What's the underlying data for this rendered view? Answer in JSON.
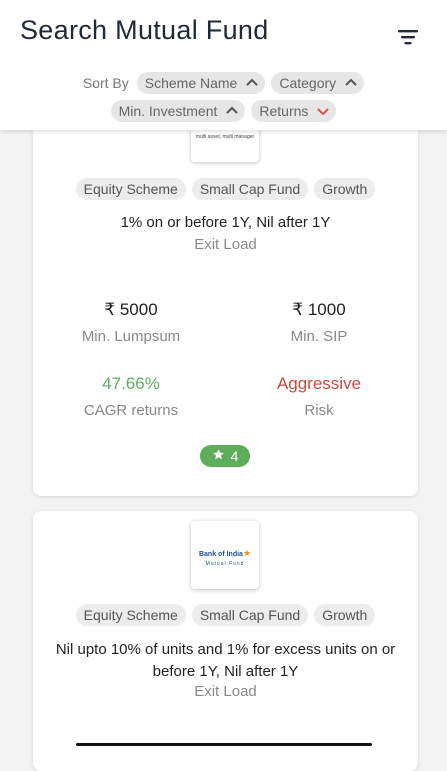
{
  "header": {
    "title": "Search Mutual Fund",
    "filter_icon": "filter-icon"
  },
  "sort": {
    "label": "Sort By",
    "options": [
      {
        "label": "Scheme Name",
        "direction": "up",
        "active": false
      },
      {
        "label": "Category",
        "direction": "up",
        "active": false
      },
      {
        "label": "Min. Investment",
        "direction": "up",
        "active": false
      },
      {
        "label": "Returns",
        "direction": "down",
        "active": true
      }
    ]
  },
  "funds": [
    {
      "logo_subtext": "multi asset, multi manager",
      "tags": [
        "Equity Scheme",
        "Small Cap Fund",
        "Growth"
      ],
      "exit_load": "1% on or before 1Y, Nil after 1Y",
      "exit_load_label": "Exit Load",
      "min_lumpsum": "₹ 5000",
      "min_lumpsum_label": "Min. Lumpsum",
      "min_sip": "₹ 1000",
      "min_sip_label": "Min. SIP",
      "cagr": "47.66%",
      "cagr_label": "CAGR returns",
      "risk": "Aggressive",
      "risk_label": "Risk",
      "rating": "4"
    },
    {
      "logo_name": "Bank of India",
      "logo_subtext": "Mutual Fund",
      "tags": [
        "Equity Scheme",
        "Small Cap Fund",
        "Growth"
      ],
      "exit_load": "Nil upto 10% of units and 1% for excess units on or before 1Y, Nil after 1Y",
      "exit_load_label": "Exit Load"
    }
  ],
  "colors": {
    "positive": "#5cae5c",
    "risk_aggressive": "#c94a3f",
    "active_sort_arrow": "#e0533f"
  }
}
